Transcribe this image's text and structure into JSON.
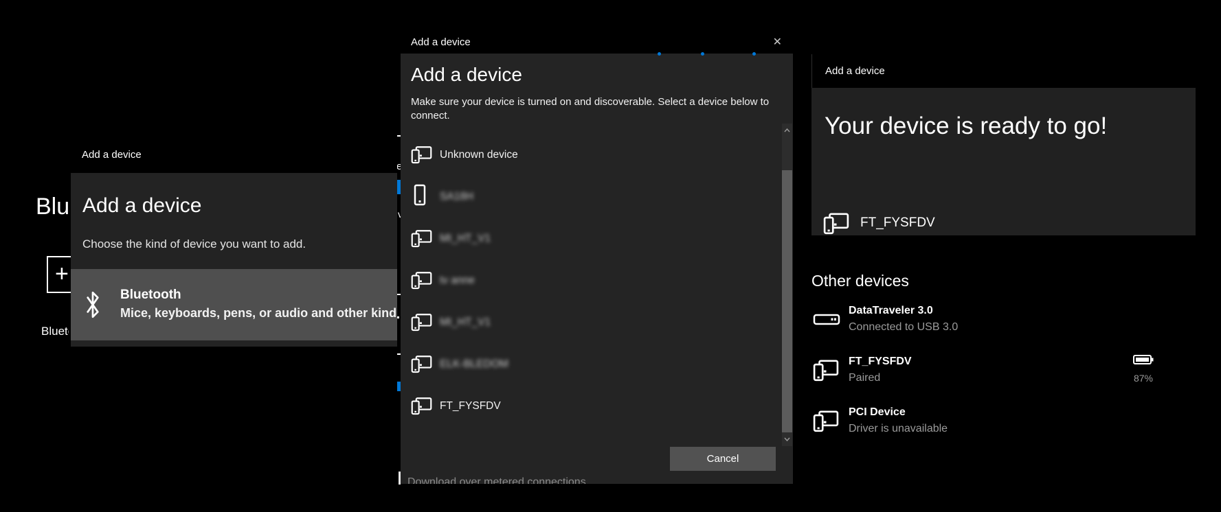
{
  "colors": {
    "accent": "#0078d7",
    "dialog_bg": "#242424",
    "titlebar_bg": "#000000",
    "highlight_row": "#4f4f4f",
    "muted_text": "#9b9b9b"
  },
  "background_page": {
    "clipped_heading": "Bluetooth & other devices",
    "add_button_glyph": "+",
    "clipped_toggle_label": "Bluetooth",
    "metered_label": "Download over metered connections",
    "fragments": {
      "e": "e",
      "v": "v"
    }
  },
  "left_dialog": {
    "titlebar": "Add a device",
    "heading": "Add a device",
    "subtitle": "Choose the kind of device you want to add.",
    "bluetooth_option": {
      "title": "Bluetooth",
      "description": "Mice, keyboards, pens, or audio and other kinds of"
    }
  },
  "center_dialog": {
    "titlebar": "Add a device",
    "close_icon": "✕",
    "heading": "Add a device",
    "instructions": "Make sure your device is turned on and discoverable. Select a device below to connect.",
    "devices": [
      {
        "name": "Unknown device",
        "icon": "pc-and-phone",
        "redacted": false
      },
      {
        "name": "SA18H",
        "icon": "phone",
        "redacted": true
      },
      {
        "name": "MI_HT_V1",
        "icon": "pc-and-phone",
        "redacted": true
      },
      {
        "name": "tv anne",
        "icon": "pc-and-phone",
        "redacted": true
      },
      {
        "name": "MI_HT_V1",
        "icon": "pc-and-phone",
        "redacted": true
      },
      {
        "name": "ELK-BLEDOM",
        "icon": "pc-and-phone",
        "redacted": true
      },
      {
        "name": "FT_FYSFDV",
        "icon": "pc-and-phone",
        "redacted": false
      }
    ],
    "cancel_label": "Cancel"
  },
  "right_dialog": {
    "titlebar": "Add a device",
    "heading": "Your device is ready to go!",
    "device_name": "FT_FYSFDV"
  },
  "other_devices": {
    "heading": "Other devices",
    "items": [
      {
        "name": "DataTraveler 3.0",
        "status": "Connected to USB 3.0",
        "icon": "usb-drive",
        "battery": null
      },
      {
        "name": "FT_FYSFDV",
        "status": "Paired",
        "icon": "pc-and-phone",
        "battery": "87%"
      },
      {
        "name": "PCI Device",
        "status": "Driver is unavailable",
        "icon": "pc-and-phone",
        "battery": null
      }
    ]
  }
}
